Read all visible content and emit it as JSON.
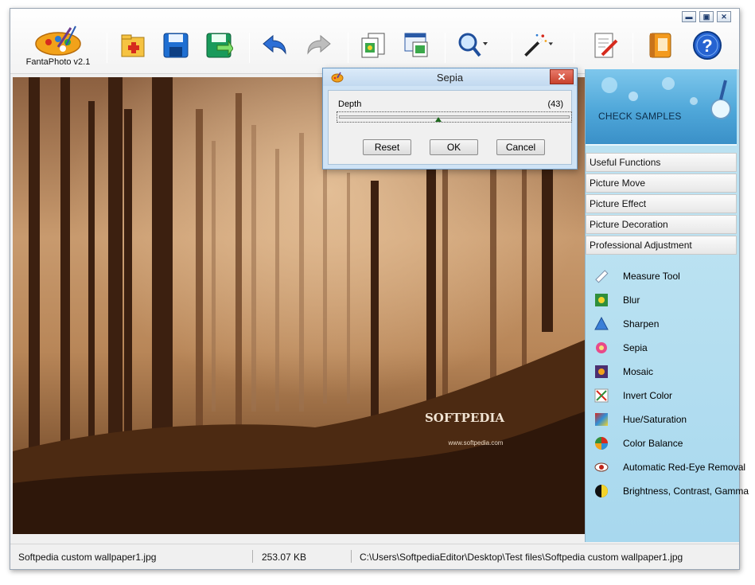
{
  "app": {
    "name": "FantaPhoto v2.1"
  },
  "toolbar": {
    "buttons": [
      {
        "name": "open-icon"
      },
      {
        "name": "save-icon"
      },
      {
        "name": "save-as-icon"
      },
      {
        "name": "undo-icon"
      },
      {
        "name": "redo-icon"
      },
      {
        "name": "copy-icon"
      },
      {
        "name": "paste-icon"
      },
      {
        "name": "zoom-icon"
      },
      {
        "name": "magic-wand-icon"
      },
      {
        "name": "edit-icon"
      },
      {
        "name": "album-icon"
      },
      {
        "name": "help-icon"
      }
    ]
  },
  "window_controls": {
    "minimize": "▬",
    "maximize": "▣",
    "close": "✕"
  },
  "image": {
    "watermark": "SOFTPEDIA",
    "watermark_url": "www.softpedia.com"
  },
  "dialog": {
    "title": "Sepia",
    "close": "✕",
    "depth_label": "Depth",
    "depth_value_text": "(43)",
    "depth_fraction": 0.43,
    "reset_label": "Reset",
    "ok_label": "OK",
    "cancel_label": "Cancel"
  },
  "sidebar": {
    "banner_label": "CHECK SAMPLES",
    "categories": [
      "Useful Functions",
      "Picture Move",
      "Picture Effect",
      "Picture Decoration",
      "Professional Adjustment"
    ],
    "tools": [
      {
        "label": "Measure Tool",
        "icon": "ruler-icon"
      },
      {
        "label": "Blur",
        "icon": "blur-icon"
      },
      {
        "label": "Sharpen",
        "icon": "sharpen-icon"
      },
      {
        "label": "Sepia",
        "icon": "sepia-icon"
      },
      {
        "label": "Mosaic",
        "icon": "mosaic-icon"
      },
      {
        "label": "Invert Color",
        "icon": "invert-icon"
      },
      {
        "label": "Hue/Saturation",
        "icon": "hue-icon"
      },
      {
        "label": "Color Balance",
        "icon": "color-balance-icon"
      },
      {
        "label": "Automatic Red-Eye Removal",
        "icon": "red-eye-icon"
      },
      {
        "label": "Brightness, Contrast, Gamma",
        "icon": "brightness-icon"
      }
    ]
  },
  "status": {
    "filename": "Softpedia custom wallpaper1.jpg",
    "filesize": "253.07 KB",
    "path": "C:\\Users\\SoftpediaEditor\\Desktop\\Test files\\Softpedia custom wallpaper1.jpg"
  }
}
